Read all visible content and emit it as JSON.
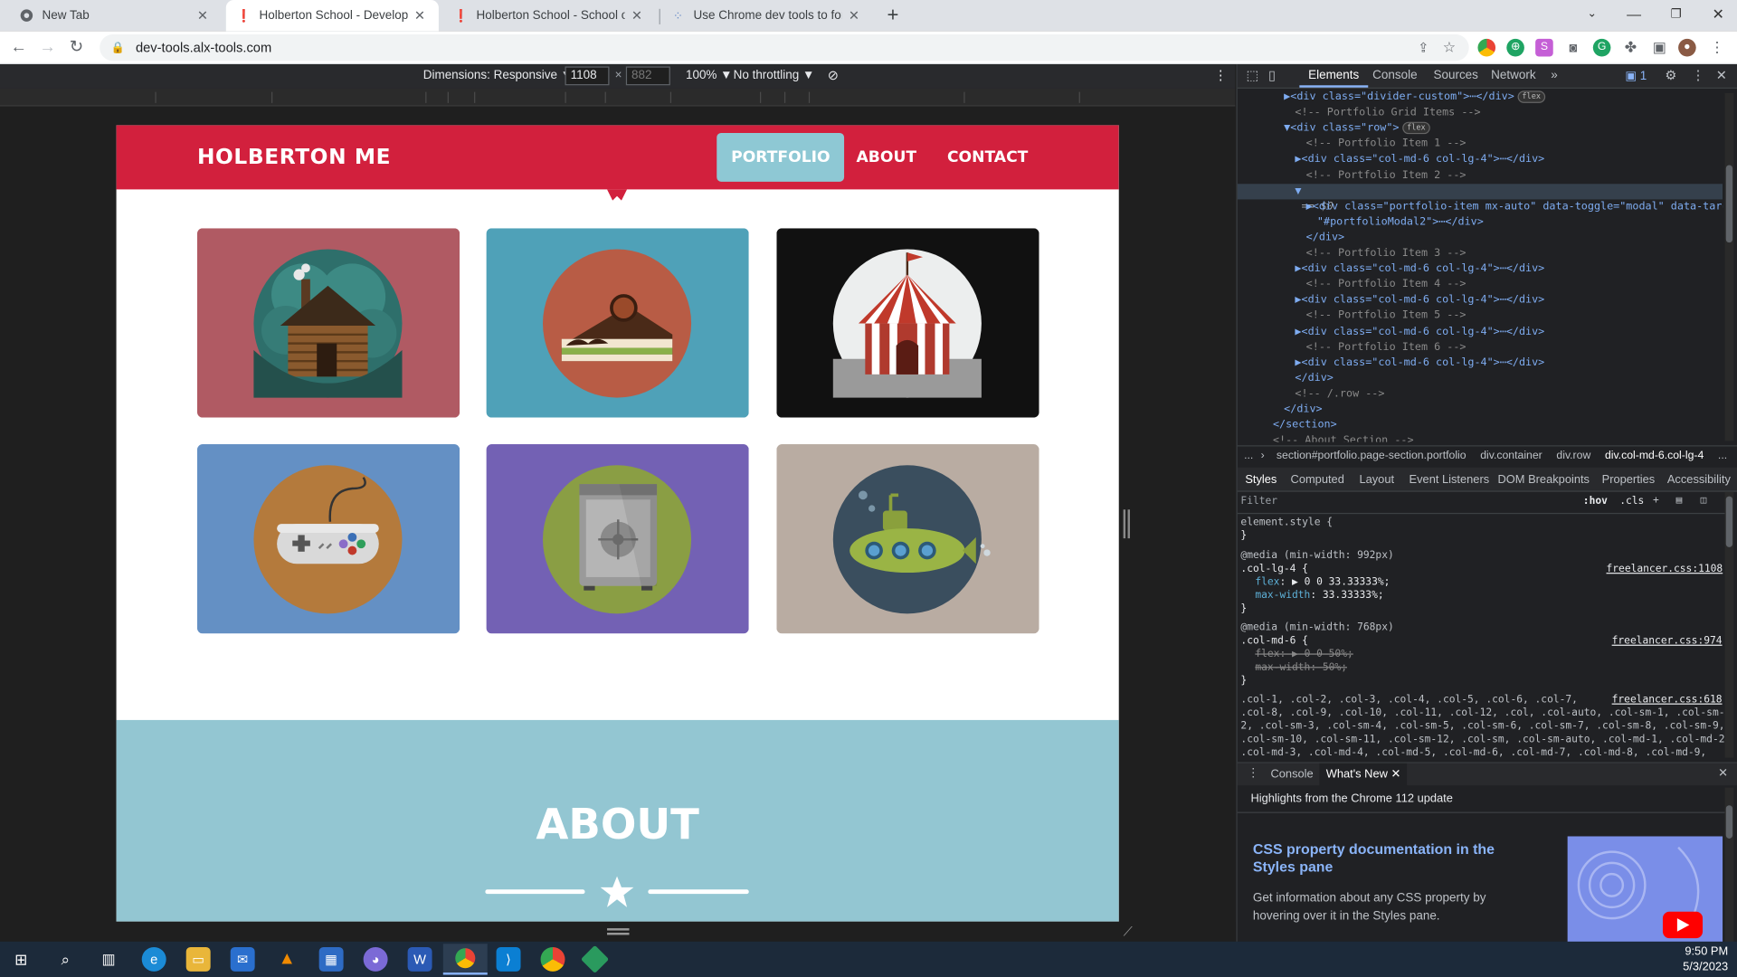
{
  "browser": {
    "tabs": [
      {
        "title": "New Tab"
      },
      {
        "title": "Holberton School - Developer to"
      },
      {
        "title": "Holberton School - School of Co"
      },
      {
        "title": "Use Chrome dev tools to force el"
      }
    ],
    "url": "dev-tools.alx-tools.com"
  },
  "device_toolbar": {
    "dimensions_label": "Dimensions: Responsive ▼",
    "width": "1108",
    "height": "882",
    "zoom": "100% ▼",
    "throttle": "No throttling ▼"
  },
  "site": {
    "brand": "HOLBERTON ME",
    "nav": [
      "PORTFOLIO",
      "ABOUT",
      "CONTACT"
    ],
    "about_title": "ABOUT",
    "portfolio_items": [
      {
        "name": "cabin",
        "bg": "#b05a63"
      },
      {
        "name": "cake",
        "bg": "#4fa1b8"
      },
      {
        "name": "circus",
        "bg": "#111111"
      },
      {
        "name": "game",
        "bg": "#6490c4"
      },
      {
        "name": "safe",
        "bg": "#7361b4"
      },
      {
        "name": "submarine",
        "bg": "#b9aca2"
      }
    ],
    "colors": {
      "brand_red": "#d2203d",
      "about_bg": "#93c6d2",
      "nav_active": "#8ec8d4"
    }
  },
  "devtools": {
    "tabs": [
      "Elements",
      "Console",
      "Sources",
      "Network",
      "»"
    ],
    "issues_count": "1",
    "dom_lines": [
      {
        "indent": 4,
        "html": "▶<div class=\"divider-custom\">⋯</div>",
        "pill": "flex"
      },
      {
        "indent": 5,
        "comment": "<!-- Portfolio Grid Items -->"
      },
      {
        "indent": 4,
        "html": "▼<div class=\"row\">",
        "pill": "flex"
      },
      {
        "indent": 6,
        "comment": "<!-- Portfolio Item 1 -->"
      },
      {
        "indent": 5,
        "html": "▶<div class=\"col-md-6 col-lg-4\">⋯</div>"
      },
      {
        "indent": 6,
        "comment": "<!-- Portfolio Item 2 -->"
      },
      {
        "indent": 5,
        "html": "▼<div class=\"col-md-6 col-lg-4\"> == $0",
        "selected": true
      },
      {
        "indent": 6,
        "html": "▶<div class=\"portfolio-item mx-auto\" data-toggle=\"modal\" data-target="
      },
      {
        "indent": 7,
        "html": "\"#portfolioModal2\">⋯</div>"
      },
      {
        "indent": 6,
        "html": "</div>"
      },
      {
        "indent": 6,
        "comment": "<!-- Portfolio Item 3 -->"
      },
      {
        "indent": 5,
        "html": "▶<div class=\"col-md-6 col-lg-4\">⋯</div>"
      },
      {
        "indent": 6,
        "comment": "<!-- Portfolio Item 4 -->"
      },
      {
        "indent": 5,
        "html": "▶<div class=\"col-md-6 col-lg-4\">⋯</div>"
      },
      {
        "indent": 6,
        "comment": "<!-- Portfolio Item 5 -->"
      },
      {
        "indent": 5,
        "html": "▶<div class=\"col-md-6 col-lg-4\">⋯</div>"
      },
      {
        "indent": 6,
        "comment": "<!-- Portfolio Item 6 -->"
      },
      {
        "indent": 5,
        "html": "▶<div class=\"col-md-6 col-lg-4\">⋯</div>"
      },
      {
        "indent": 5,
        "html": "</div>"
      },
      {
        "indent": 5,
        "comment": "<!-- /.row -->"
      },
      {
        "indent": 4,
        "html": "</div>"
      },
      {
        "indent": 3,
        "html": "</section>"
      },
      {
        "indent": 3,
        "comment": "<!-- About Section -->"
      }
    ],
    "breadcrumb": [
      "...",
      "section#portfolio.page-section.portfolio",
      "div.container",
      "div.row",
      "div.col-md-6.col-lg-4",
      "..."
    ],
    "subtabs": [
      "Styles",
      "Computed",
      "Layout",
      "Event Listeners",
      "DOM Breakpoints",
      "Properties",
      "Accessibility"
    ],
    "filter_placeholder": "Filter",
    "hov": ":hov",
    "cls": ".cls",
    "styles": {
      "element_style": "element.style {",
      "media1": "@media (min-width: 992px)",
      "rule1": ".col-lg-4 {",
      "rule1_link": "freelancer.css:1108",
      "rule1_props": [
        [
          "flex",
          "▶ 0 0 33.33333%;"
        ],
        [
          "max-width",
          "33.33333%;"
        ]
      ],
      "media2": "@media (min-width: 768px)",
      "rule2": ".col-md-6 {",
      "rule2_link": "freelancer.css:974",
      "rule2_props": [
        [
          "flex",
          "▶ 0 0 50%;"
        ],
        [
          "max-width",
          "50%;"
        ]
      ],
      "rule3_link": "freelancer.css:618",
      "rule3_lines": [
        ".col-1, .col-2, .col-3, .col-4, .col-5, .col-6, .col-7,",
        ".col-8, .col-9, .col-10, .col-11, .col-12, .col, .col-auto, .col-sm-1, .col-sm-",
        "2, .col-sm-3, .col-sm-4, .col-sm-5, .col-sm-6, .col-sm-7, .col-sm-8, .col-sm-9,",
        ".col-sm-10, .col-sm-11, .col-sm-12, .col-sm, .col-sm-auto, .col-md-1, .col-md-2,",
        ".col-md-3, .col-md-4, .col-md-5, .col-md-6, .col-md-7, .col-md-8, .col-md-9,"
      ]
    },
    "drawer": {
      "tabs": [
        "Console",
        "What's New"
      ],
      "highlights": "Highlights from the Chrome 112 update",
      "heading": "CSS property documentation in the Styles pane",
      "body": "Get information about any CSS property by hovering over it in the Styles pane."
    }
  },
  "taskbar": {
    "time": "9:50 PM",
    "date": "5/3/2023"
  }
}
